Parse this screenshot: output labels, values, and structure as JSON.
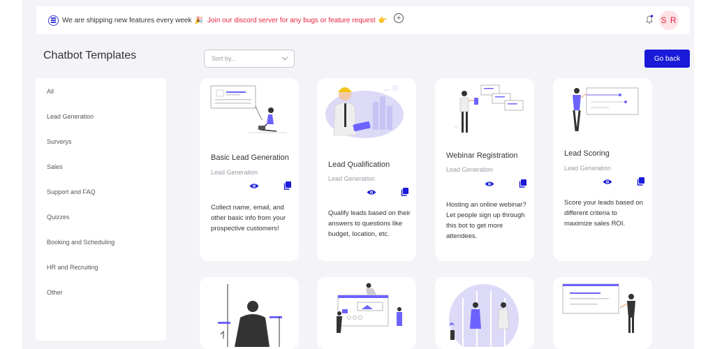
{
  "announcement": {
    "text": "We are shipping new features every week",
    "party_emoji": "🎉",
    "discord_link": "Join our discord server for any bugs or feature request",
    "hand_emoji": "👉",
    "plus_symbol": "+"
  },
  "header": {
    "avatar_initials": "S R"
  },
  "page": {
    "title": "Chatbot Templates",
    "sort_placeholder": "Sort by...",
    "go_back_label": "Go back"
  },
  "sidebar": {
    "items": [
      {
        "label": "All"
      },
      {
        "label": "Lead Generation"
      },
      {
        "label": "Surverys"
      },
      {
        "label": "Sales"
      },
      {
        "label": "Support and FAQ"
      },
      {
        "label": "Quizzes"
      },
      {
        "label": "Booking and Scheduling"
      },
      {
        "label": "HR and Recruiting"
      },
      {
        "label": "Other"
      }
    ]
  },
  "cards": [
    {
      "title": "Basic Lead Generation",
      "category": "Lead Generation",
      "description": "Collect name, email, and other basic info from your prospective customers!"
    },
    {
      "title": "Lead Qualification",
      "category": "Lead Generation",
      "description": "Qualify leads based on their answers to questions like budget, location, etc."
    },
    {
      "title": "Webinar Registration",
      "category": "Lead Generation",
      "description": "Hosting an online webinar? Let people sign up through this bot to get more attendees."
    },
    {
      "title": "Lead Scoring",
      "category": "Lead Generation",
      "description": "Score your leads based on different criteria to maximize sales ROI."
    }
  ],
  "colors": {
    "accent": "#1a1ad8",
    "link_red": "#e8233e",
    "illustration_purple": "#6c63ff",
    "background": "#f3f3f8"
  }
}
